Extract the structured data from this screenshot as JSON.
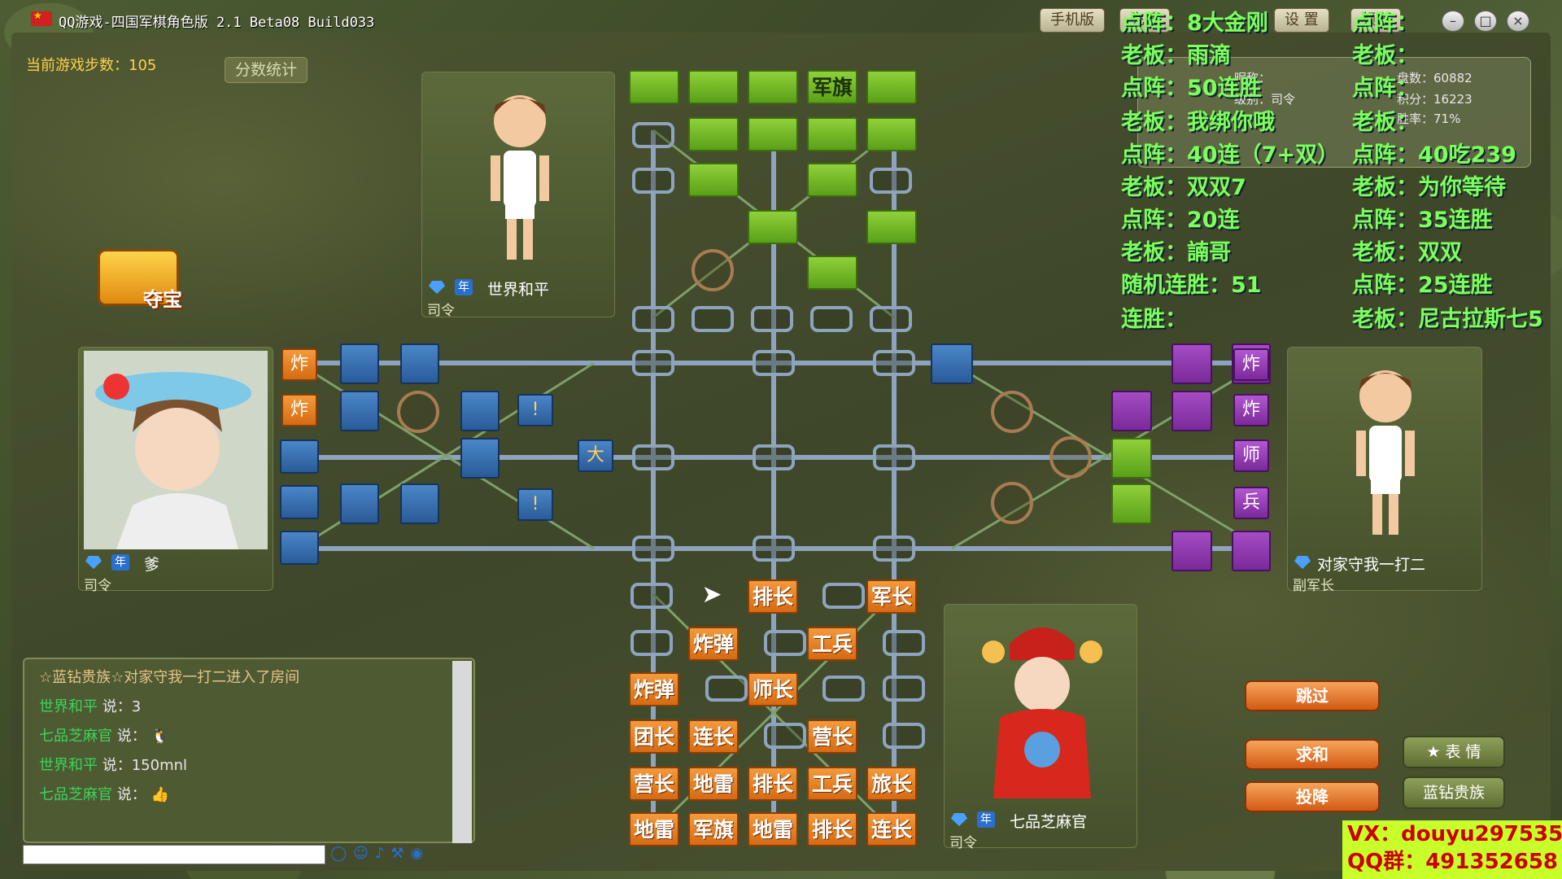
{
  "window": {
    "title": "QQ游戏-四国军棋角色版 2.1 Beta08 Build033",
    "buttons": {
      "mobile": "手机版",
      "recharge": "充值",
      "settings": "设 置",
      "channel": "频道"
    }
  },
  "game": {
    "step_label": "当前游戏步数：",
    "step_count": "105",
    "score_stats": "分数统计",
    "treasure_label": "夺宝"
  },
  "players": {
    "top": {
      "name": "世界和平",
      "rank": "司令"
    },
    "left": {
      "name": "爹",
      "rank": "司令"
    },
    "right": {
      "name": "对家守我一打二",
      "rank": "副军长"
    },
    "bottom": {
      "name": "七品芝麻官",
      "rank": "司令"
    }
  },
  "board": {
    "top_flag": "军旗",
    "left_tags": [
      "炸",
      "炸"
    ],
    "left_marks": [
      "!",
      "!",
      "大"
    ],
    "right_tags": [
      "炸",
      "炸",
      "师",
      "兵"
    ],
    "bottom_pieces": [
      [
        "",
        "",
        "排长",
        "",
        "军长"
      ],
      [
        "",
        "炸弹",
        "",
        "工兵",
        ""
      ],
      [
        "炸弹",
        "",
        "师长",
        "",
        ""
      ],
      [
        "团长",
        "连长",
        "",
        "营长",
        ""
      ],
      [
        "营长",
        "地雷",
        "排长",
        "工兵",
        "旅长"
      ],
      [
        "地雷",
        "军旗",
        "地雷",
        "排长",
        "连长"
      ]
    ]
  },
  "chat": {
    "messages": [
      {
        "system": "☆蓝钻贵族☆对家守我一打二进入了房间"
      },
      {
        "who": "世界和平",
        "said": "说：3"
      },
      {
        "who": "七品芝麻官",
        "said": "说："
      },
      {
        "who": "世界和平",
        "said": "说：150mnl"
      },
      {
        "who": "七品芝麻官",
        "said": "说："
      }
    ]
  },
  "actions": {
    "skip": "跳过",
    "draw": "求和",
    "surrender": "投降",
    "emote": "表 情",
    "vip": "蓝钻贵族"
  },
  "score_box": {
    "nickname_label": "昵称：",
    "level_label": "级别：司令",
    "games": "盘数：60882",
    "points": "积分：16223",
    "winrate": "胜率：71%"
  },
  "overlay": {
    "left_col": [
      "点阵：8大金刚",
      "老板：雨滴",
      "点阵：50连胜",
      "老板：我绑你哦",
      "点阵：40连（7+双）",
      "老板：双双7",
      "点阵：20连",
      "老板：諵哥",
      "随机连胜：51",
      "连胜："
    ],
    "right_col": [
      "点阵：",
      "老板：",
      "点阵：",
      "老板：",
      "点阵：40吃239",
      "老板：为你等待",
      "点阵：35连胜",
      "老板：双双",
      "点阵：25连胜",
      "老板：尼古拉斯七5"
    ],
    "vx": "VX：douyu297535",
    "qq": "QQ群：491352658"
  }
}
